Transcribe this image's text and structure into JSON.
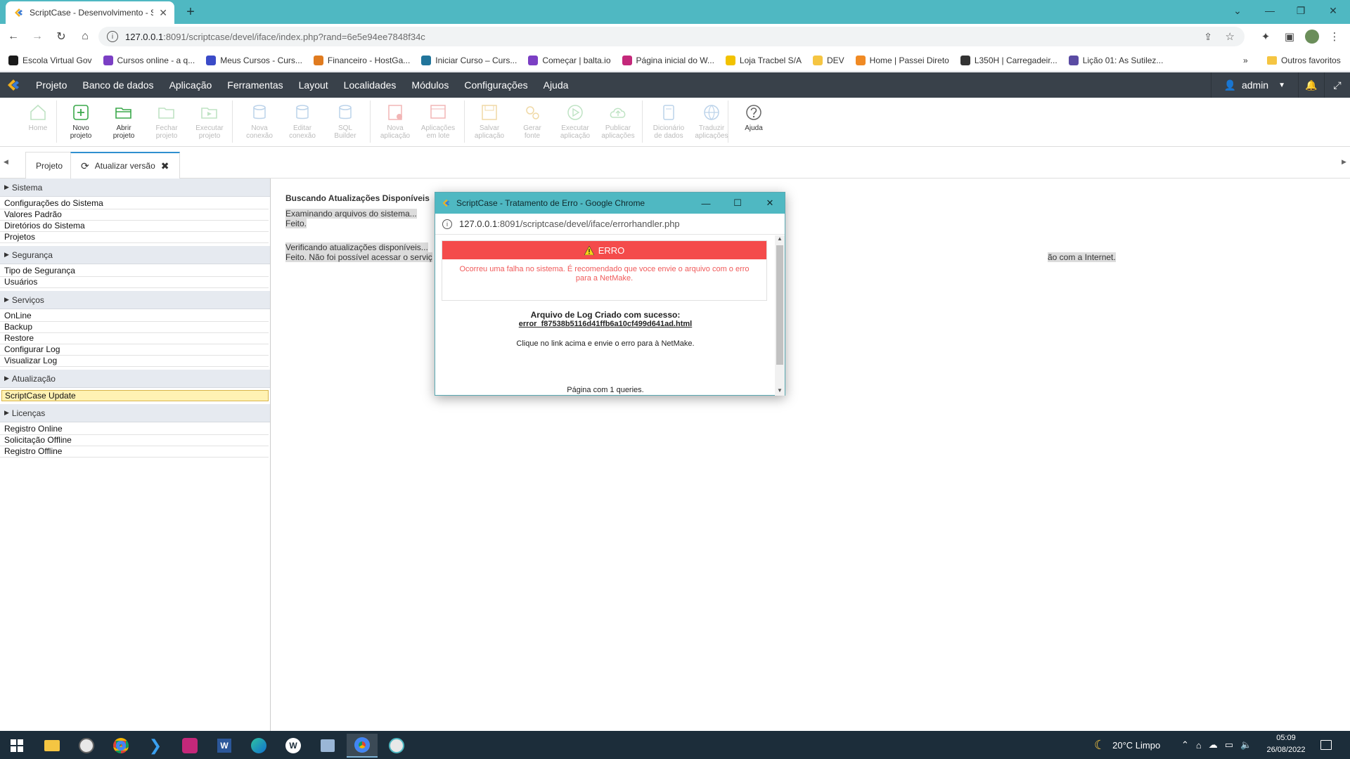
{
  "browser": {
    "tab_title": "ScriptCase - Desenvolvimento - S",
    "url_host": "127.0.0.1",
    "url_path": ":8091/scriptcase/devel/iface/index.php?rand=6e5e94ee7848f34c",
    "accent": "#4fb8c2"
  },
  "bookmarks": [
    {
      "label": "Escola Virtual Gov",
      "color": "#1a1a1a"
    },
    {
      "label": "Cursos online - a q...",
      "color": "#7b3fc4"
    },
    {
      "label": "Meus Cursos - Curs...",
      "color": "#3b4bc8"
    },
    {
      "label": "Financeiro - HostGa...",
      "color": "#e07b1f"
    },
    {
      "label": "Iniciar Curso – Curs...",
      "color": "#21759b"
    },
    {
      "label": "Começar | balta.io",
      "color": "#7b3fc4"
    },
    {
      "label": "Página inicial do W...",
      "color": "#c4287a"
    },
    {
      "label": "Loja Tracbel S/A",
      "color": "#f2c200"
    },
    {
      "label": "DEV",
      "color": "#f5c542"
    },
    {
      "label": "Home | Passei Direto",
      "color": "#f08a24"
    },
    {
      "label": "L350H | Carregadeir...",
      "color": "#333333"
    },
    {
      "label": "Lição 01: As Sutilez...",
      "color": "#5a4ba3"
    }
  ],
  "bookmarks_more": "»",
  "bookmarks_other": "Outros favoritos",
  "menu": {
    "items": [
      "Projeto",
      "Banco de dados",
      "Aplicação",
      "Ferramentas",
      "Layout",
      "Localidades",
      "Módulos",
      "Configurações",
      "Ajuda"
    ],
    "user": "admin"
  },
  "toolbar": [
    {
      "label1": "Home",
      "label2": "",
      "enabled": false,
      "icon": "home-icon"
    },
    {
      "label1": "Novo",
      "label2": "projeto",
      "enabled": true,
      "icon": "new-project-icon"
    },
    {
      "label1": "Abrir",
      "label2": "projeto",
      "enabled": true,
      "icon": "open-folder-icon"
    },
    {
      "label1": "Fechar",
      "label2": "projeto",
      "enabled": false,
      "icon": "close-folder-icon"
    },
    {
      "label1": "Executar",
      "label2": "projeto",
      "enabled": false,
      "icon": "run-project-icon"
    },
    {
      "label1": "Nova",
      "label2": "conexão",
      "enabled": false,
      "icon": "new-connection-icon"
    },
    {
      "label1": "Editar",
      "label2": "conexão",
      "enabled": false,
      "icon": "edit-connection-icon"
    },
    {
      "label1": "SQL",
      "label2": "Builder",
      "enabled": false,
      "icon": "sql-builder-icon"
    },
    {
      "label1": "Nova",
      "label2": "aplicação",
      "enabled": false,
      "icon": "new-app-icon"
    },
    {
      "label1": "Aplicações",
      "label2": "em lote",
      "enabled": false,
      "icon": "batch-apps-icon"
    },
    {
      "label1": "Salvar",
      "label2": "aplicação",
      "enabled": false,
      "icon": "save-icon"
    },
    {
      "label1": "Gerar",
      "label2": "fonte",
      "enabled": false,
      "icon": "generate-icon"
    },
    {
      "label1": "Executar",
      "label2": "aplicação",
      "enabled": false,
      "icon": "run-app-icon"
    },
    {
      "label1": "Publicar",
      "label2": "aplicações",
      "enabled": false,
      "icon": "publish-icon"
    },
    {
      "label1": "Dicionário",
      "label2": "de dados",
      "enabled": false,
      "icon": "dictionary-icon"
    },
    {
      "label1": "Traduzir",
      "label2": "aplicações",
      "enabled": false,
      "icon": "translate-icon"
    },
    {
      "label1": "Ajuda",
      "label2": "",
      "enabled": true,
      "icon": "help-icon"
    }
  ],
  "tabs": {
    "project": "Projeto",
    "update": "Atualizar versão"
  },
  "sidebar": {
    "groups": [
      {
        "title": "Sistema",
        "items": [
          "Configurações do Sistema",
          "Valores Padrão",
          "Diretórios do Sistema",
          "Projetos"
        ]
      },
      {
        "title": "Segurança",
        "items": [
          "Tipo de Segurança",
          "Usuários"
        ]
      },
      {
        "title": "Serviços",
        "items": [
          "OnLine",
          "Backup",
          "Restore",
          "Configurar Log",
          "Visualizar Log"
        ]
      },
      {
        "title": "Atualização",
        "items": [
          "ScriptCase Update"
        ]
      },
      {
        "title": "Licenças",
        "items": [
          "Registro Online",
          "Solicitação Offline",
          "Registro Offline"
        ]
      }
    ],
    "selected": "ScriptCase Update"
  },
  "content": {
    "heading": "Buscando Atualizações Disponíveis",
    "line1": "Examinando arquivos do sistema...",
    "line2": "Feito.",
    "line3": "Verificando atualizações disponíveis...",
    "line4_start": "Feito. Não foi possível acessar o serviç",
    "line4_end": "ão com a Internet."
  },
  "popup": {
    "title": "ScriptCase - Tratamento de Erro - Google Chrome",
    "url_host": "127.0.0.1",
    "url_path": ":8091/scriptcase/devel/iface/errorhandler.php",
    "error_label": "ERRO",
    "error_message": "Ocorreu uma falha no sistema. É recomendado que voce envie o arquivo com o erro para a NetMake.",
    "log_title": "Arquivo de Log Criado com sucesso:",
    "log_file": "error_f87538b5116d41ffb6a10cf499d641ad.html",
    "log_instruction": "Clique no link acima e envie o erro para à NetMake.",
    "queries": "Página com 1 queries.",
    "error_color": "#f44b4b"
  },
  "taskbar": {
    "weather": "20°C  Limpo",
    "time": "05:09",
    "date": "26/08/2022"
  }
}
